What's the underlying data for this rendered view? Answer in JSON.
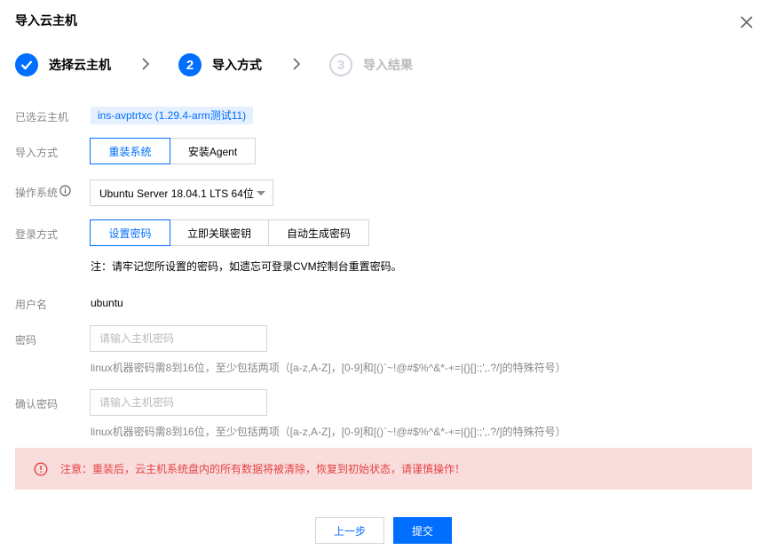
{
  "dialog": {
    "title": "导入云主机"
  },
  "steps": [
    {
      "number": "",
      "label": "选择云主机",
      "state": "done"
    },
    {
      "number": "2",
      "label": "导入方式",
      "state": "active"
    },
    {
      "number": "3",
      "label": "导入结果",
      "state": "pending"
    }
  ],
  "form": {
    "selected_host_label": "已选云主机",
    "selected_host_value": "ins-avptrtxc (1.29.4-arm测试11)",
    "import_method_label": "导入方式",
    "import_method_options": [
      "重装系统",
      "安装Agent"
    ],
    "import_method_selected": "重装系统",
    "os_label": "操作系统",
    "os_value": "Ubuntu Server 18.04.1 LTS 64位",
    "login_label": "登录方式",
    "login_options": [
      "设置密码",
      "立即关联密钥",
      "自动生成密码"
    ],
    "login_selected": "设置密码",
    "login_note": "注：请牢记您所设置的密码，如遗忘可登录CVM控制台重置密码。",
    "username_label": "用户名",
    "username_value": "ubuntu",
    "password_label": "密码",
    "password_placeholder": "请输入主机密码",
    "password_hint": "linux机器密码需8到16位，至少包括两项（[a-z,A-Z]，[0-9]和[()`~!@#$%^&*-+=|{}[]:;',.?/]的特殊符号）",
    "confirm_label": "确认密码",
    "confirm_placeholder": "请输入主机密码",
    "confirm_hint": "linux机器密码需8到16位，至少包括两项（[a-z,A-Z]，[0-9]和[()`~!@#$%^&*-+=|{}[]:;',.?/]的特殊符号）"
  },
  "warning": {
    "text": "注意：重装后，云主机系统盘内的所有数据将被清除，恢复到初始状态，请谨慎操作！"
  },
  "footer": {
    "prev_label": "上一步",
    "submit_label": "提交"
  },
  "colors": {
    "primary": "#006eff",
    "warning_bg": "#f9dcdc",
    "warning_text": "#e54545",
    "muted": "#888888"
  },
  "icons": {
    "close": "close-icon",
    "step_done": "check-icon",
    "step_separator": "chevron-right-icon",
    "os_info": "info-icon",
    "warning": "alert-circle-icon",
    "os_dropdown": "caret-down-icon"
  }
}
